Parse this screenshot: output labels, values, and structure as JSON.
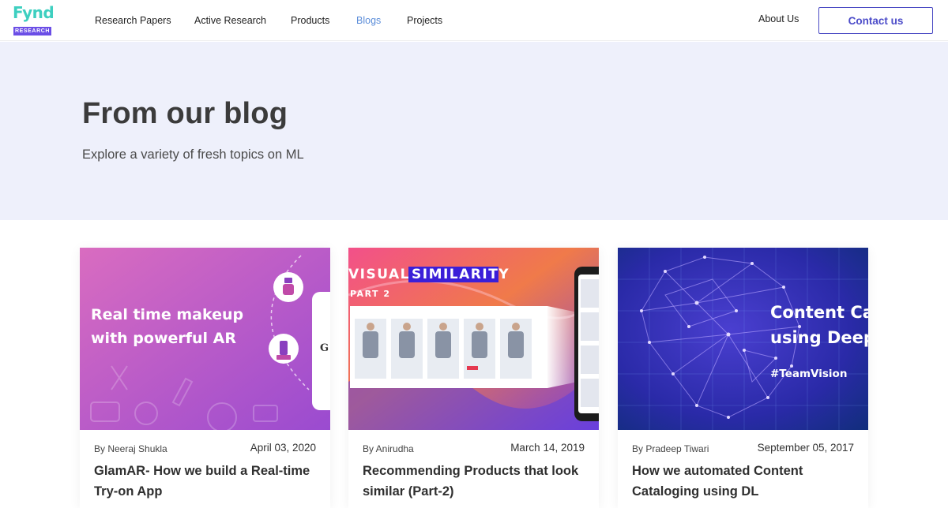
{
  "brand": {
    "name": "Fynd",
    "sub": "RESEARCH",
    "accent": "#3ecfc0",
    "sub_bg": "#6b4ee6"
  },
  "nav": {
    "items": [
      {
        "label": "Research Papers",
        "active": false
      },
      {
        "label": "Active Research",
        "active": false
      },
      {
        "label": "Products",
        "active": false
      },
      {
        "label": "Blogs",
        "active": true
      },
      {
        "label": "Projects",
        "active": false
      }
    ],
    "about": "About Us",
    "contact": "Contact us",
    "active_color": "#5b8dd9"
  },
  "hero": {
    "title": "From our blog",
    "subtitle": "Explore a variety of fresh topics on ML",
    "bg": "#eef0fb"
  },
  "cards": [
    {
      "author": "By Neeraj Shukla",
      "date": "April 03, 2020",
      "title": "GlamAR- How we build a Real-time Try-on App",
      "image_lines": [
        "Real time makeup",
        "with powerful AR"
      ],
      "image_glyph": "G"
    },
    {
      "author": "By Anirudha",
      "date": "March 14, 2019",
      "title": "Recommending Products that look similar (Part-2)",
      "image_lines": [
        "VISUAL",
        "SIMILARITY",
        "PART 2"
      ]
    },
    {
      "author": "By Pradeep Tiwari",
      "date": "September 05, 2017",
      "title": "How we automated Content Cataloging using DL",
      "image_lines": [
        "Content Ca",
        "using Deep",
        "#TeamVision"
      ]
    }
  ]
}
